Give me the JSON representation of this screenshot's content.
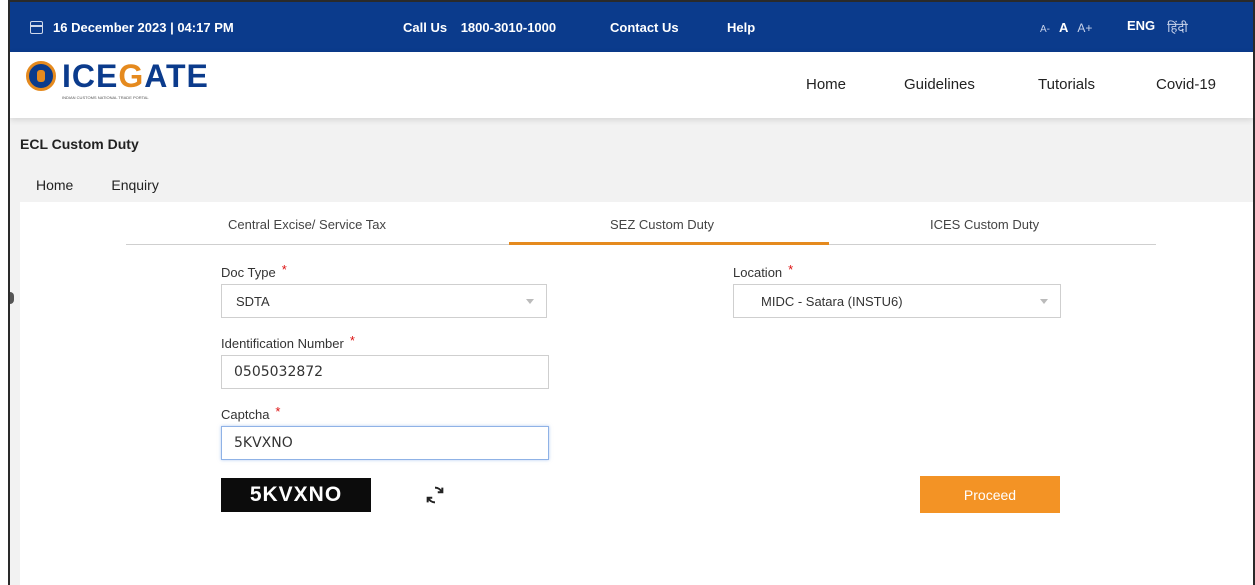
{
  "topbar": {
    "date": "16 December 2023 | 04:17 PM",
    "call_label": "Call Us",
    "call_number": "1800-3010-1000",
    "contact": "Contact Us",
    "help": "Help",
    "font_small": "A-",
    "font_normal": "A",
    "font_large": "A+",
    "lang_en": "ENG",
    "lang_hi": "हिंदी"
  },
  "header": {
    "logo_text_a": "ICE",
    "logo_text_b": "G",
    "logo_text_c": "ATE",
    "logo_sub": "INDIAN CUSTOMS NATIONAL TRADE PORTAL",
    "nav": [
      "Home",
      "Guidelines",
      "Tutorials",
      "Covid-19"
    ]
  },
  "page": {
    "title": "ECL Custom Duty",
    "crumbs": [
      "Home",
      "Enquiry"
    ]
  },
  "tabs": [
    {
      "label": "Central Excise/ Service Tax",
      "active": false
    },
    {
      "label": "SEZ Custom Duty",
      "active": true
    },
    {
      "label": "ICES Custom Duty",
      "active": false
    }
  ],
  "form": {
    "doc_type_label": "Doc Type",
    "doc_type_value": "SDTA",
    "location_label": "Location",
    "location_value": "MIDC - Satara (INSTU6)",
    "id_label": "Identification Number",
    "id_value": "0505032872",
    "captcha_label": "Captcha",
    "captcha_value": "5KVXNO",
    "captcha_image_text": "5KVXNO",
    "required_mark": "*",
    "proceed": "Proceed"
  },
  "colors": {
    "topbar": "#0b3b8c",
    "accent": "#f39325",
    "required": "#dd1111"
  }
}
